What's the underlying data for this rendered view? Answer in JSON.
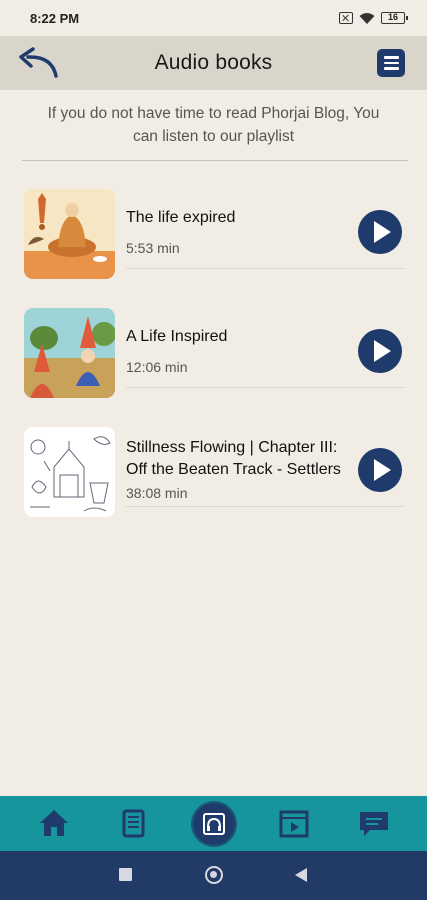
{
  "status_bar": {
    "time": "8:22 PM",
    "battery": "16"
  },
  "header": {
    "title": "Audio books"
  },
  "subtitle": "If you do not have time to read Phorjai Blog, You can listen to our playlist",
  "books": [
    {
      "title": "The life expired",
      "duration": "5:53 min"
    },
    {
      "title": "A Life Inspired",
      "duration": "12:06 min"
    },
    {
      "title": "Stillness Flowing | Chapter III: Off the Beaten Track - Settlers",
      "duration": "38:08 min"
    }
  ],
  "colors": {
    "accent": "#1f3b6b",
    "nav_bg": "#17959d",
    "background": "#f2ede4"
  },
  "bottom_nav": [
    "home-icon",
    "book-icon",
    "audiobook-icon",
    "video-icon",
    "chat-icon"
  ]
}
